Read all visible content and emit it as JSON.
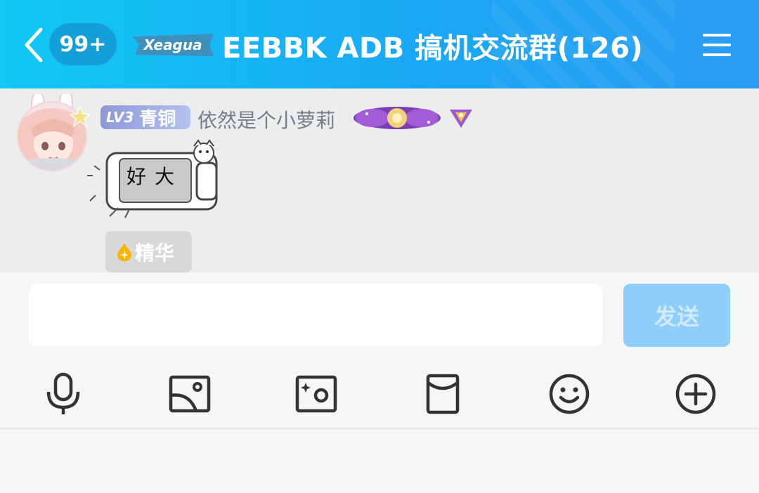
{
  "header": {
    "unread_count": "99+",
    "group_title": "EEBBK  ADB 搞机交流群(126)",
    "logo_text": "Xeagua"
  },
  "message": {
    "level_label": "LV3",
    "rank_label": "青铜",
    "nickname": "依然是个小萝莉",
    "sticker_text": "好大",
    "essence_label": "精华"
  },
  "composer": {
    "input_value": "",
    "input_placeholder": "",
    "send_label": "发送"
  },
  "toolbar": {
    "items": [
      "microphone-icon",
      "image-icon",
      "camera-icon",
      "red-packet-icon",
      "emoji-icon",
      "plus-icon"
    ]
  },
  "colors": {
    "header_gradient_start": "#12c8f5",
    "header_gradient_end": "#2a9cf2",
    "send_button": "#8fcdfb",
    "level_badge": "#8d98d8",
    "essence_icon": "#f6b500"
  }
}
